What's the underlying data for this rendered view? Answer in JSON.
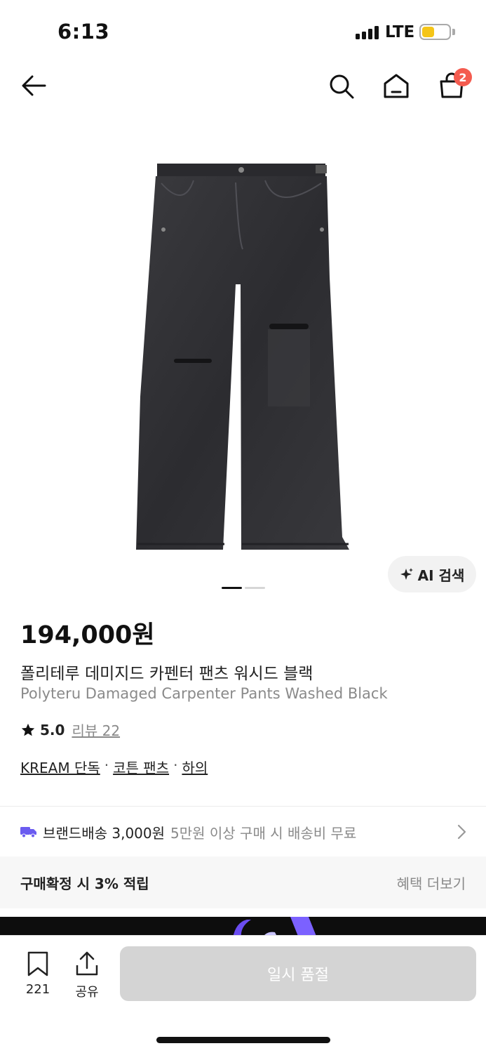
{
  "status_bar": {
    "time": "6:13",
    "network": "LTE",
    "battery_level": 0.45
  },
  "nav": {
    "cart_count": "2"
  },
  "ai_search": {
    "label": "AI 검색"
  },
  "product": {
    "price": "194,000원",
    "name_ko": "폴리테루 데미지드 카펜터 팬츠 워시드 블랙",
    "name_en": "Polyteru Damaged Carpenter Pants Washed Black",
    "rating": "5.0",
    "review_label": "리뷰 22",
    "tags": [
      "KREAM 단독",
      "코튼 팬츠",
      "하의"
    ],
    "tag_separator": "·"
  },
  "shipping": {
    "brand_text": "브랜드배송 3,000원",
    "note": "5만원 이상 구매 시 배송비 무료"
  },
  "points": {
    "label": "구매확정 시 3% 적립",
    "more": "혜택 더보기"
  },
  "bottom_bar": {
    "bookmark_count": "221",
    "share_label": "공유",
    "action_label": "일시 품절"
  },
  "colors": {
    "badge": "#f45b4f",
    "shipping_icon": "#6b5cf0",
    "disabled_button": "#d4d4d4"
  }
}
